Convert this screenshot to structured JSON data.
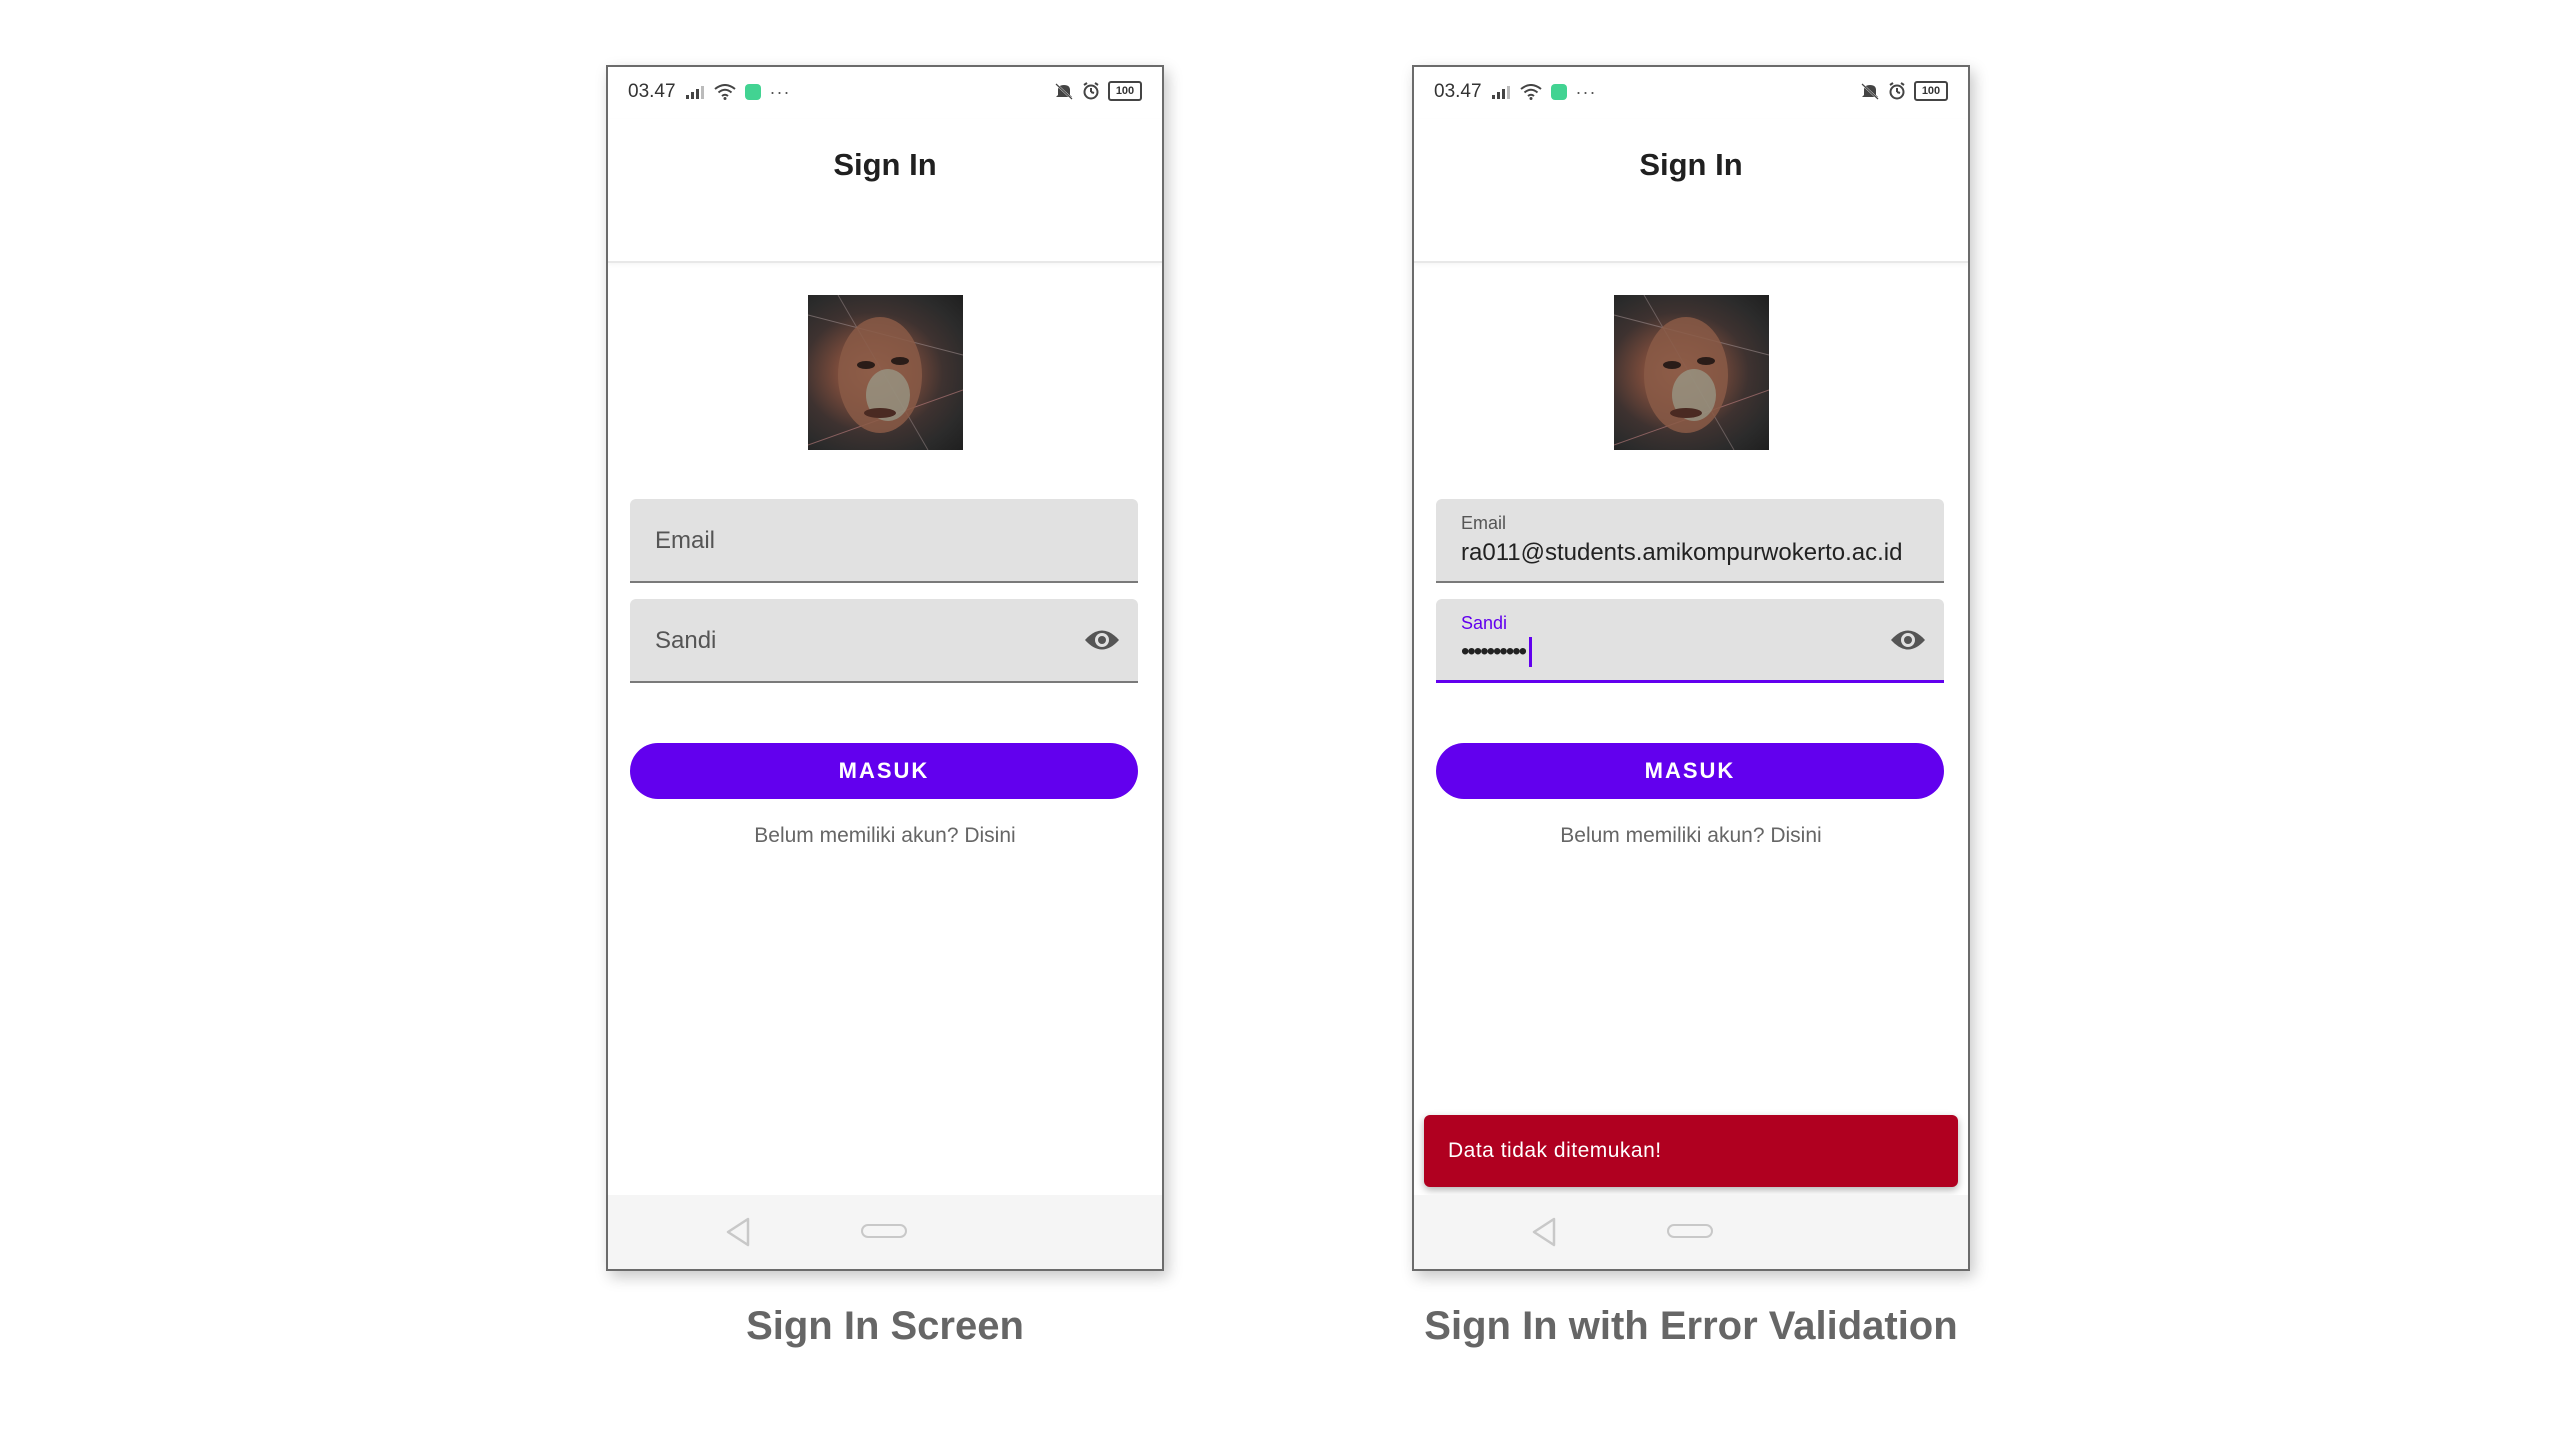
{
  "colors": {
    "primary": "#6200ee",
    "error": "#b00020",
    "field_bg": "#e1e1e1"
  },
  "screens": [
    {
      "status": {
        "time": "03.47",
        "extra": "···",
        "battery": "100"
      },
      "title": "Sign In",
      "email": {
        "placeholder": "Email",
        "label": "",
        "value": ""
      },
      "password": {
        "placeholder": "Sandi",
        "label": "",
        "dots": ""
      },
      "button_label": "MASUK",
      "signup_text": "Belum memiliki akun? Disini",
      "snackbar": "",
      "caption": "Sign In Screen"
    },
    {
      "status": {
        "time": "03.47",
        "extra": "···",
        "battery": "100"
      },
      "title": "Sign In",
      "email": {
        "placeholder": "",
        "label": "Email",
        "value": "ra011@students.amikompurwokerto.ac.id"
      },
      "password": {
        "placeholder": "",
        "label": "Sandi",
        "dots": "••••••••••"
      },
      "button_label": "MASUK",
      "signup_text": "Belum memiliki akun? Disini",
      "snackbar": "Data tidak ditemukan!",
      "caption": "Sign In with Error Validation"
    }
  ],
  "icons": [
    "signal-icon",
    "wifi-icon",
    "app-notification-icon",
    "mute-icon",
    "alarm-icon",
    "battery-icon",
    "eye-icon",
    "back-nav-icon",
    "home-nav-icon"
  ]
}
